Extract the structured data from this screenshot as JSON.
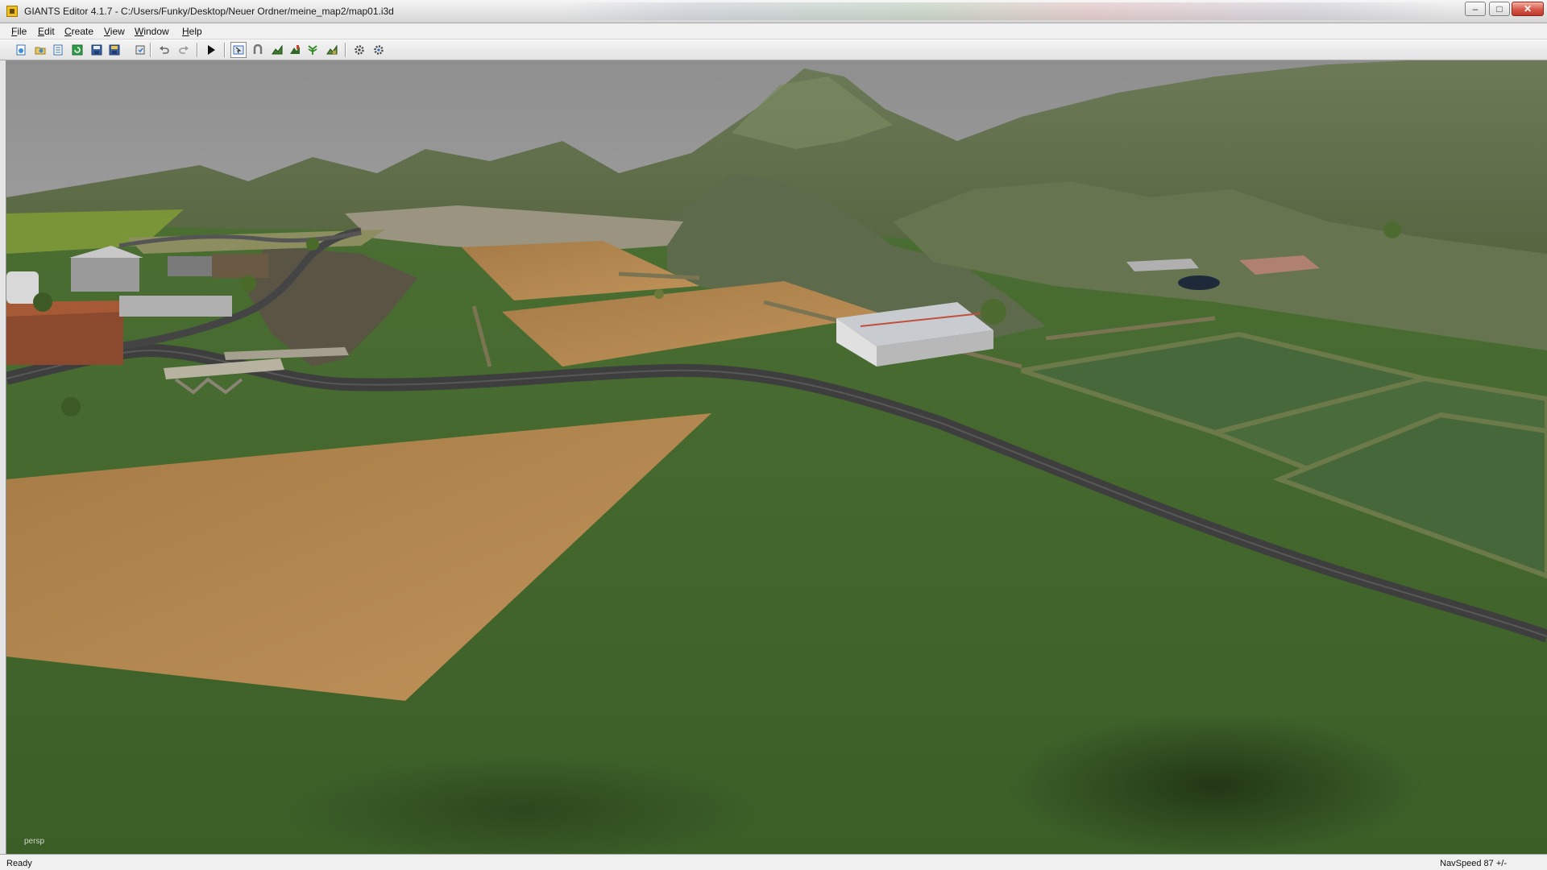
{
  "window": {
    "title": "GIANTS Editor 4.1.7 - C:/Users/Funky/Desktop/Neuer Ordner/meine_map2/map01.i3d",
    "controls": {
      "minimize": "–",
      "maximize": "□",
      "close": "✕"
    }
  },
  "menu": {
    "items": [
      {
        "label": "File"
      },
      {
        "label": "Edit"
      },
      {
        "label": "Create"
      },
      {
        "label": "View"
      },
      {
        "label": "Window"
      },
      {
        "label": "Help"
      }
    ]
  },
  "toolbar": {
    "buttons": [
      {
        "icon": "new-scene-icon"
      },
      {
        "icon": "open-icon"
      },
      {
        "icon": "list-icon"
      },
      {
        "icon": "refresh-icon"
      },
      {
        "icon": "save-icon"
      },
      {
        "icon": "save-all-icon"
      },
      {
        "icon": "import-icon"
      },
      {
        "icon": "undo-icon"
      },
      {
        "icon": "redo-icon"
      },
      {
        "icon": "play-icon"
      },
      {
        "icon": "select-mode-icon",
        "active": true
      },
      {
        "icon": "magnet-icon"
      },
      {
        "icon": "terrain-sculpt-icon"
      },
      {
        "icon": "terrain-paint-icon"
      },
      {
        "icon": "foliage-paint-icon"
      },
      {
        "icon": "terrain-detail-icon"
      },
      {
        "icon": "settings-gear-icon"
      },
      {
        "icon": "settings-gear-2-icon"
      }
    ]
  },
  "viewport": {
    "camera_label": "persp"
  },
  "status": {
    "left": "Ready",
    "right": "NavSpeed 87 +/-"
  },
  "colors": {
    "sky": "#9c9c9c",
    "grass": "#3f6529",
    "field": "#b98a4f",
    "road": "#4a4a4a",
    "mountain": "#6d7561"
  }
}
